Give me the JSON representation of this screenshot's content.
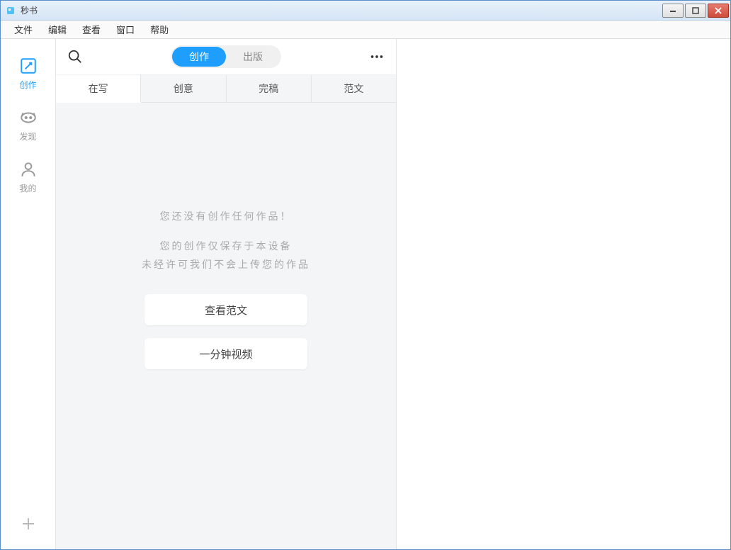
{
  "window": {
    "title": "秒书"
  },
  "menubar": {
    "items": [
      "文件",
      "编辑",
      "查看",
      "窗口",
      "帮助"
    ]
  },
  "sidebar": {
    "items": [
      {
        "label": "创作",
        "icon": "compose-icon",
        "active": true
      },
      {
        "label": "发现",
        "icon": "discover-icon",
        "active": false
      },
      {
        "label": "我的",
        "icon": "profile-icon",
        "active": false
      }
    ]
  },
  "panel": {
    "segmented": {
      "items": [
        {
          "label": "创作",
          "active": true
        },
        {
          "label": "出版",
          "active": false
        }
      ]
    },
    "tabs": {
      "items": [
        {
          "label": "在写",
          "active": true
        },
        {
          "label": "创意",
          "active": false
        },
        {
          "label": "完稿",
          "active": false
        },
        {
          "label": "范文",
          "active": false
        }
      ]
    },
    "empty": {
      "primary": "您还没有创作任何作品！",
      "line1": "您的创作仅保存于本设备",
      "line2": "未经许可我们不会上传您的作品",
      "button1": "查看范文",
      "button2": "一分钟视频"
    }
  }
}
